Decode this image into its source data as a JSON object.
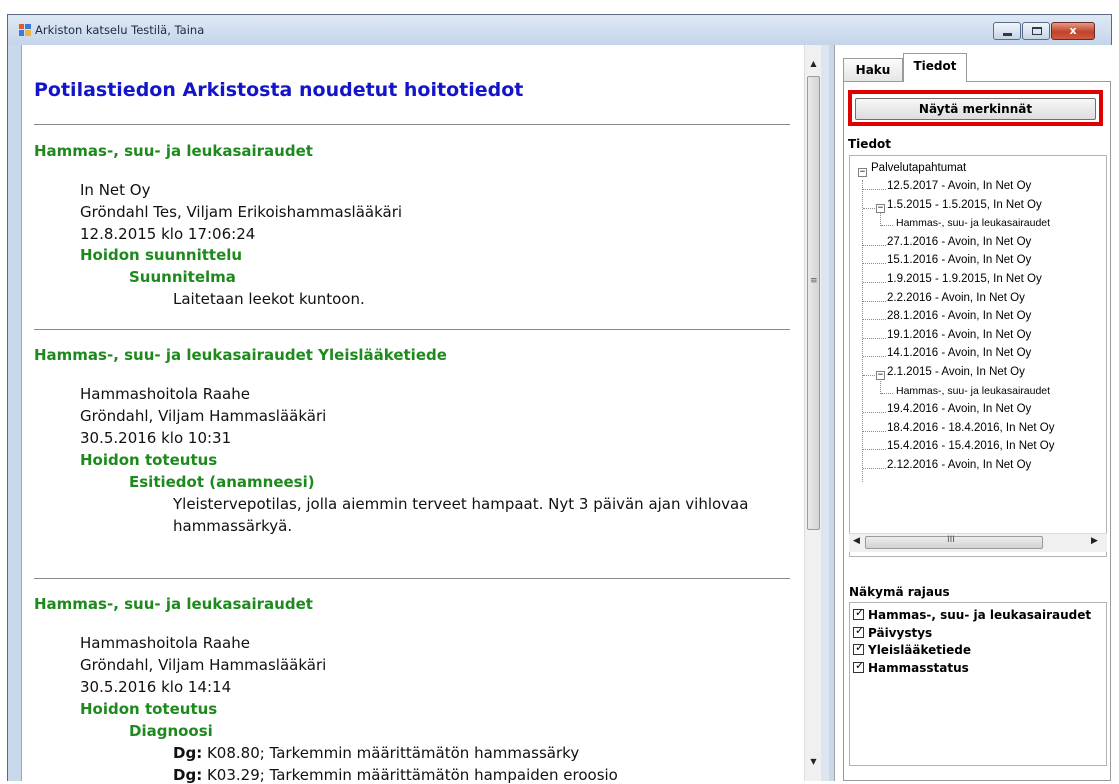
{
  "window": {
    "title": "Arkiston katselu Testilä, Taina",
    "close_glyph": "x"
  },
  "document": {
    "heading": "Potilastiedon Arkistosta noudetut hoitotiedot",
    "sections": [
      {
        "title": "Hammas-, suu- ja leukasairaudet",
        "lines": [
          "In Net Oy",
          "Gröndahl Tes, Viljam Erikoishammaslääkäri",
          "12.8.2015 klo 17:06:24"
        ],
        "sub1": "Hoidon suunnittelu",
        "sub2": "Suunnitelma",
        "body": [
          "Laitetaan leekot kuntoon."
        ]
      },
      {
        "title": "Hammas-, suu- ja leukasairaudet Yleislääketiede",
        "lines": [
          "Hammashoitola Raahe",
          "Gröndahl, Viljam Hammaslääkäri",
          "30.5.2016 klo 10:31"
        ],
        "sub1": "Hoidon toteutus",
        "sub2": "Esitiedot (anamneesi)",
        "body": [
          "Yleistervepotilas, jolla aiemmin terveet hampaat. Nyt 3 päivän ajan vihlovaa",
          "hammassärkyä."
        ]
      },
      {
        "title": "Hammas-, suu- ja leukasairaudet",
        "lines": [
          "Hammashoitola Raahe",
          "Gröndahl, Viljam Hammaslääkäri",
          "30.5.2016 klo 14:14"
        ],
        "sub1": "Hoidon toteutus",
        "sub2": "Diagnoosi",
        "dg": [
          {
            "prefix": "Dg:",
            "text": " K08.80; Tarkemmin määrittämätön hammassärky"
          },
          {
            "prefix": "Dg:",
            "text": " K03.29; Tarkemmin määrittämätön hampaiden eroosio"
          }
        ]
      }
    ]
  },
  "scroll": {
    "up": "▲",
    "down": "▼",
    "grip": "≡",
    "left": "◀",
    "right": "▶",
    "hgrip": "III"
  },
  "splitter": {
    "arrow": ">"
  },
  "right_panel": {
    "tabs": [
      {
        "label": "Haku"
      },
      {
        "label": "Tiedot"
      }
    ],
    "active_tab": "Tiedot",
    "show_button": "Näytä merkinnät",
    "tiedot_label": "Tiedot",
    "tree": {
      "root": "Palvelutapahtumat",
      "root_expander": "−",
      "items": [
        {
          "label": "12.5.2017 - Avoin, In Net Oy"
        },
        {
          "label": "1.5.2015 - 1.5.2015, In Net Oy",
          "expander": "−",
          "child": "Hammas-, suu- ja leukasairaudet"
        },
        {
          "label": "27.1.2016 - Avoin, In Net Oy"
        },
        {
          "label": "15.1.2016 - Avoin, In Net Oy"
        },
        {
          "label": "1.9.2015 - 1.9.2015, In Net Oy"
        },
        {
          "label": "2.2.2016 - Avoin, In Net Oy"
        },
        {
          "label": "28.1.2016 - Avoin, In Net Oy"
        },
        {
          "label": "19.1.2016 - Avoin, In Net Oy"
        },
        {
          "label": "14.1.2016 - Avoin, In Net Oy"
        },
        {
          "label": "2.1.2015 - Avoin, In Net Oy",
          "expander": "−",
          "child": "Hammas-, suu- ja leukasairaudet"
        },
        {
          "label": "19.4.2016 - Avoin, In Net Oy"
        },
        {
          "label": "18.4.2016 - 18.4.2016, In Net Oy"
        },
        {
          "label": "15.4.2016 - 15.4.2016, In Net Oy"
        },
        {
          "label": "2.12.2016 - Avoin, In Net Oy"
        }
      ]
    },
    "filter": {
      "label": "Näkymä rajaus",
      "checked_glyph": "✓",
      "options": [
        {
          "label": "Hammas-, suu- ja leukasairaudet",
          "checked": true
        },
        {
          "label": "Päivystys",
          "checked": true
        },
        {
          "label": "Yleislääketiede",
          "checked": true
        },
        {
          "label": "Hammasstatus",
          "checked": true
        }
      ]
    }
  },
  "colors": {
    "heading_blue": "#1414c8",
    "section_green": "#1e8a1e",
    "highlight_red": "#e00000"
  }
}
